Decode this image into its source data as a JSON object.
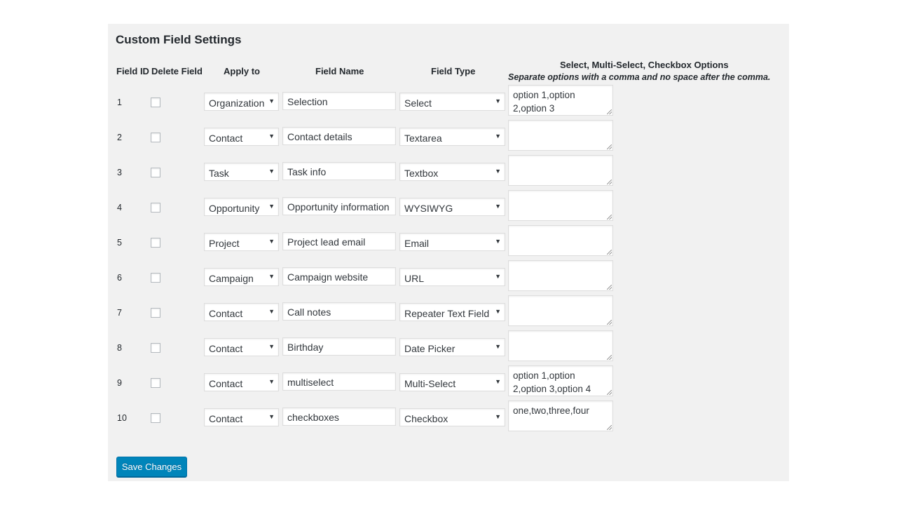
{
  "page": {
    "title": "Custom Field Settings",
    "headers": {
      "field_id": "Field ID",
      "delete_field": "Delete Field",
      "apply_to": "Apply to",
      "field_name": "Field Name",
      "field_type": "Field Type",
      "options": "Select, Multi-Select, Checkbox Options",
      "options_note": "Separate options with a comma and no space after the comma."
    },
    "rows": [
      {
        "id": "1",
        "apply_to": "Organization",
        "name": "Selection",
        "type": "Select",
        "options": "option 1,option 2,option 3"
      },
      {
        "id": "2",
        "apply_to": "Contact",
        "name": "Contact details",
        "type": "Textarea",
        "options": ""
      },
      {
        "id": "3",
        "apply_to": "Task",
        "name": "Task info",
        "type": "Textbox",
        "options": ""
      },
      {
        "id": "4",
        "apply_to": "Opportunity",
        "name": "Opportunity information",
        "type": "WYSIWYG",
        "options": ""
      },
      {
        "id": "5",
        "apply_to": "Project",
        "name": "Project lead email",
        "type": "Email",
        "options": ""
      },
      {
        "id": "6",
        "apply_to": "Campaign",
        "name": "Campaign website",
        "type": "URL",
        "options": ""
      },
      {
        "id": "7",
        "apply_to": "Contact",
        "name": "Call notes",
        "type": "Repeater Text Field",
        "options": ""
      },
      {
        "id": "8",
        "apply_to": "Contact",
        "name": "Birthday",
        "type": "Date Picker",
        "options": ""
      },
      {
        "id": "9",
        "apply_to": "Contact",
        "name": "multiselect",
        "type": "Multi-Select",
        "options": "option 1,option 2,option 3,option 4"
      },
      {
        "id": "10",
        "apply_to": "Contact",
        "name": "checkboxes",
        "type": "Checkbox",
        "options": "one,two,three,four"
      }
    ],
    "save_label": "Save Changes",
    "dropdown_icon": "triangle-down",
    "colors": {
      "panel_bg": "#f1f1f1",
      "button_bg": "#0085ba"
    }
  }
}
